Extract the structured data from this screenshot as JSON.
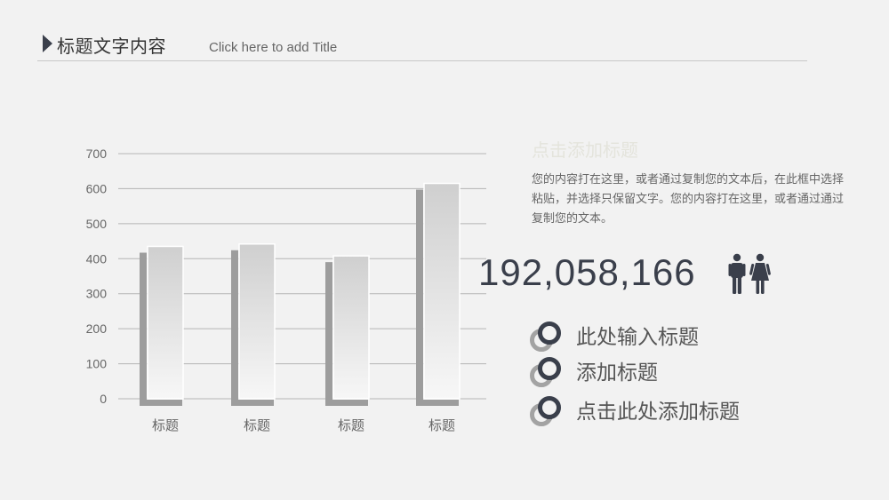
{
  "header": {
    "title": "标题文字内容",
    "subtitle": "Click here to add Title"
  },
  "chart_data": {
    "type": "bar",
    "categories": [
      "标题",
      "标题",
      "标题",
      "标题"
    ],
    "values": [
      435,
      442,
      408,
      615
    ],
    "ylim": [
      0,
      700
    ],
    "yticks": [
      0,
      100,
      200,
      300,
      400,
      500,
      600,
      700
    ],
    "grid": true,
    "legend": "none",
    "colors": {
      "bar_top": "#cfcfcf",
      "bar_bottom": "#f7f7f7",
      "bar_shadow": "#9d9d9d",
      "grid": "#b5b5b5"
    }
  },
  "info": {
    "title": "点击添加标题",
    "body": "您的内容打在这里，或者通过复制您的文本后，在此框中选择粘贴，并选择只保留文字。您的内容打在这里，或者通过通过复制您的文本。"
  },
  "stat": {
    "number": "192,058,166",
    "icon": "people-icon"
  },
  "bullets": [
    {
      "label": "此处输入标题"
    },
    {
      "label": "添加标题"
    },
    {
      "label": "点击此处添加标题"
    }
  ],
  "colors": {
    "dark": "#3a3f4b",
    "background": "#f2f2f2"
  }
}
